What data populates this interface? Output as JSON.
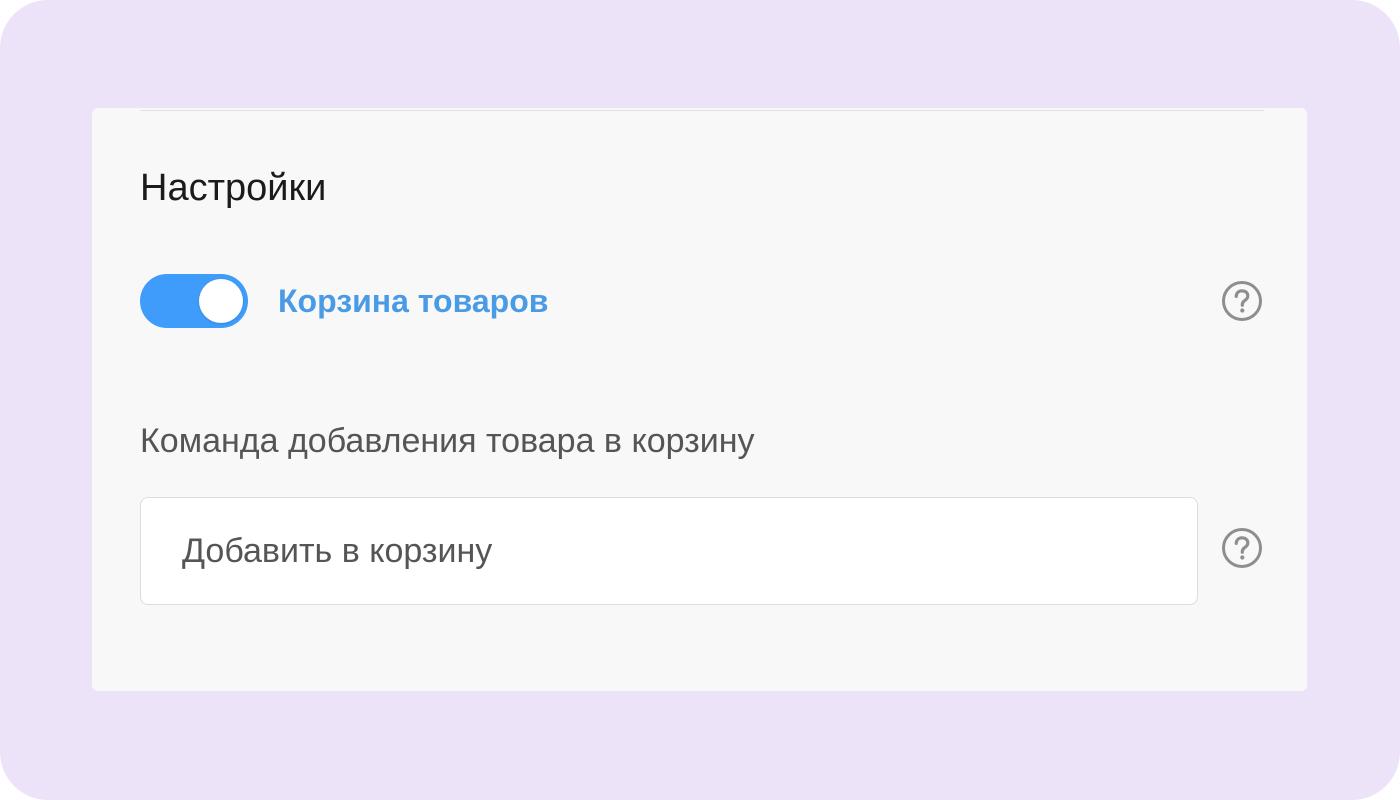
{
  "settings": {
    "title": "Настройки",
    "cart_toggle": {
      "label": "Корзина товаров",
      "enabled": true,
      "color": "#3f9cfb",
      "label_color": "#4a9be5"
    },
    "add_command": {
      "label": "Команда добавления товара в корзину",
      "value": "Добавить в корзину"
    },
    "help_icon": "question-circle-icon"
  },
  "colors": {
    "background": "#ede3f8",
    "panel": "#f8f8f8",
    "accent": "#3f9cfb"
  }
}
